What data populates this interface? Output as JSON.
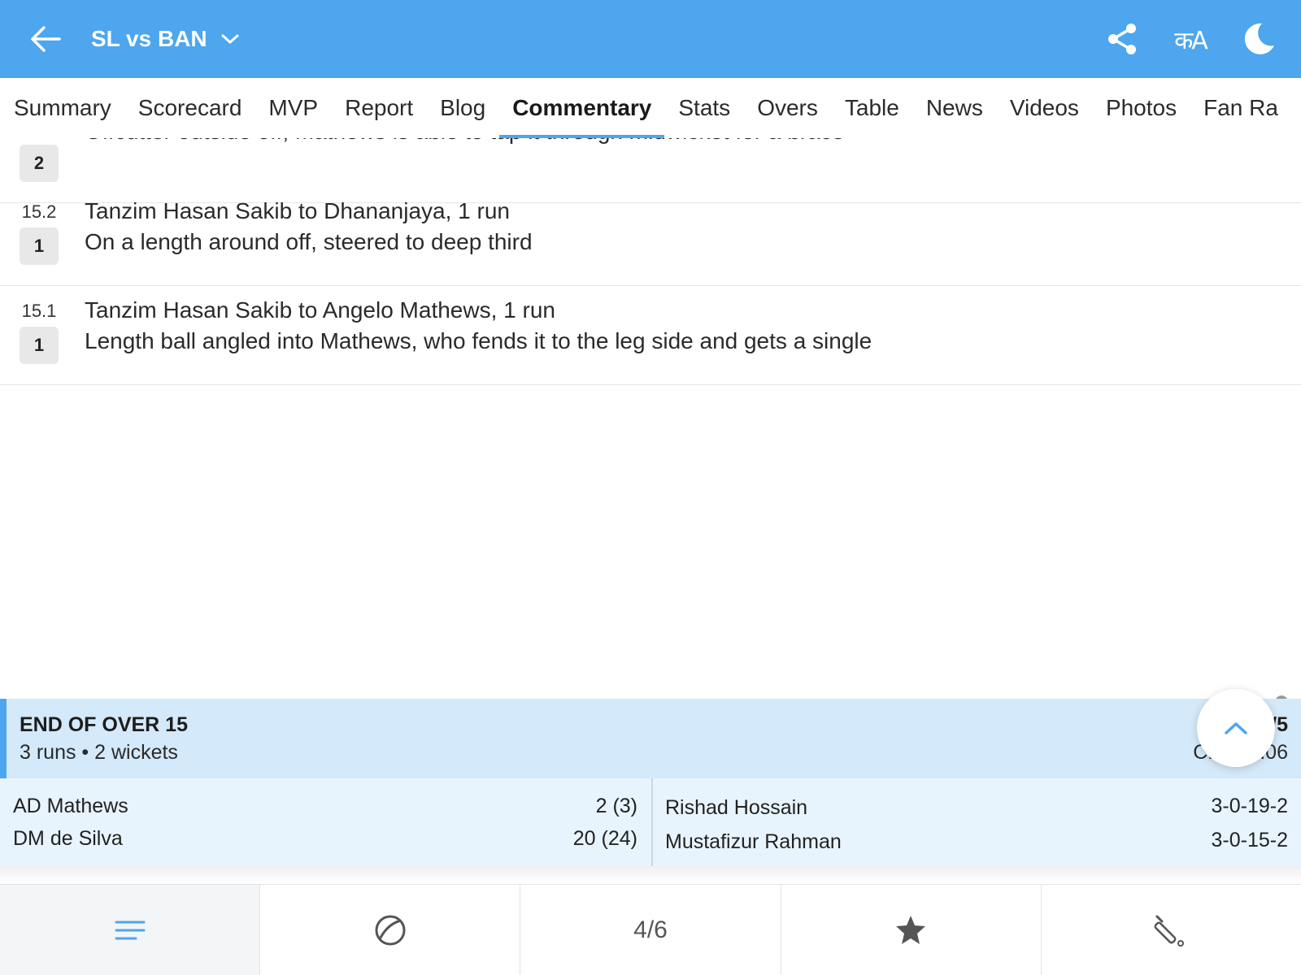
{
  "header": {
    "match_title": "SL vs BAN",
    "language_label": "कA",
    "back_icon": "arrow-left-icon",
    "share_icon": "share-icon",
    "theme_icon": "moon-icon"
  },
  "tabs": [
    {
      "label": "Summary",
      "active": false
    },
    {
      "label": "Scorecard",
      "active": false
    },
    {
      "label": "MVP",
      "active": false
    },
    {
      "label": "Report",
      "active": false
    },
    {
      "label": "Blog",
      "active": false
    },
    {
      "label": "Commentary",
      "active": true
    },
    {
      "label": "Stats",
      "active": false
    },
    {
      "label": "Overs",
      "active": false
    },
    {
      "label": "Table",
      "active": false
    },
    {
      "label": "News",
      "active": false
    },
    {
      "label": "Videos",
      "active": false
    },
    {
      "label": "Photos",
      "active": false
    },
    {
      "label": "Fan Ra",
      "active": false
    }
  ],
  "commentary": [
    {
      "ball": "",
      "runs": "2",
      "headline": "",
      "text": "Offcutter outside off, Mathews is able to tap it through midwicket for a brace"
    },
    {
      "ball": "15.2",
      "runs": "1",
      "headline": "Tanzim Hasan Sakib to Dhananjaya, 1 run",
      "text": "On a length around off, steered to deep third"
    },
    {
      "ball": "15.1",
      "runs": "1",
      "headline": "Tanzim Hasan Sakib to Angelo Mathews, 1 run",
      "text": "Length ball angled into Mathews, who fends it to the leg side and gets a single"
    }
  ],
  "end_of_over": {
    "title": "END OF OVER 15",
    "summary": "3 runs • 2 wickets",
    "score": "SL: 75/5",
    "run_rate": "CRR: 5.06",
    "batters": [
      {
        "name": "AD Mathews",
        "score": "2 (3)"
      },
      {
        "name": "DM de Silva",
        "score": "20 (24)"
      }
    ],
    "bowlers": [
      {
        "name": "Rishad Hossain",
        "figures": "3-0-19-2"
      },
      {
        "name": "Mustafizur Rahman",
        "figures": "3-0-15-2"
      }
    ]
  },
  "bottom_nav": {
    "items": [
      "menu-icon",
      "ball-icon",
      "page-counter",
      "star-icon",
      "bat-icon"
    ],
    "page_counter": "4/6"
  },
  "colors": {
    "brand_blue": "#4da6ee",
    "over_head_bg": "#d4e9f9",
    "over_panel_bg": "#e8f4fd"
  }
}
